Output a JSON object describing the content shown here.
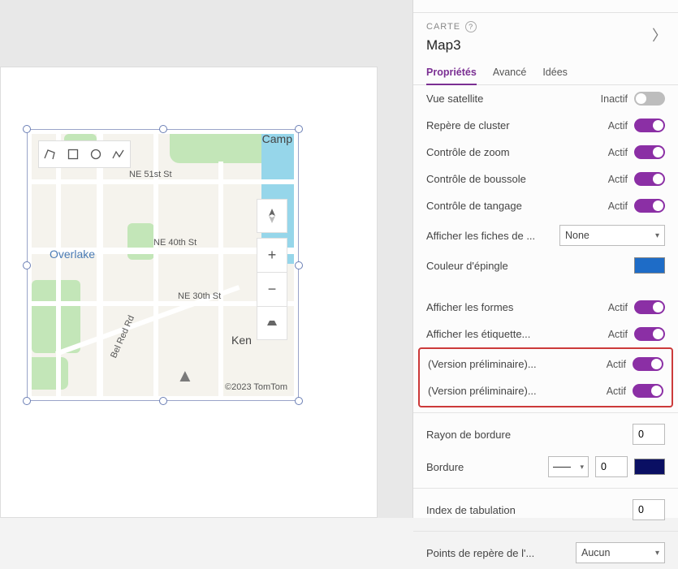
{
  "panel": {
    "type_label": "CARTE",
    "name": "Map3",
    "tabs": {
      "properties": "Propriétés",
      "advanced": "Avancé",
      "ideas": "Idées"
    }
  },
  "props": {
    "satellite": {
      "label": "Vue satellite",
      "status": "Inactif",
      "on": false
    },
    "cluster": {
      "label": "Repère de cluster",
      "status": "Actif",
      "on": true
    },
    "zoom": {
      "label": "Contrôle de zoom",
      "status": "Actif",
      "on": true
    },
    "compass": {
      "label": "Contrôle de boussole",
      "status": "Actif",
      "on": true
    },
    "pitch": {
      "label": "Contrôle de tangage",
      "status": "Actif",
      "on": true
    },
    "infocards": {
      "label": "Afficher les fiches de ...",
      "value": "None"
    },
    "pincolor": {
      "label": "Couleur d'épingle",
      "color": "#1e6cc7"
    },
    "shapes": {
      "label": "Afficher les formes",
      "status": "Actif",
      "on": true
    },
    "labels": {
      "label": "Afficher les étiquette...",
      "status": "Actif",
      "on": true
    },
    "preview1": {
      "label": "(Version préliminaire)...",
      "status": "Actif",
      "on": true
    },
    "preview2": {
      "label": "(Version préliminaire)...",
      "status": "Actif",
      "on": true
    },
    "radius": {
      "label": "Rayon de bordure",
      "value": "0"
    },
    "border": {
      "label": "Bordure",
      "width": "0",
      "color": "#0a0f63"
    },
    "tabindex": {
      "label": "Index de tabulation",
      "value": "0"
    },
    "waypoints": {
      "label": "Points de repère de l'...",
      "value": "Aucun"
    }
  },
  "map": {
    "attribution": "©2023 TomTom",
    "places": {
      "overlake": "Overlake",
      "camp": "Camp",
      "ken": "Ken"
    },
    "streets": {
      "ne51": "NE 51st St",
      "ne40": "NE 40th St",
      "ne30": "NE 30th St",
      "belred": "Bel Red Rd"
    }
  }
}
